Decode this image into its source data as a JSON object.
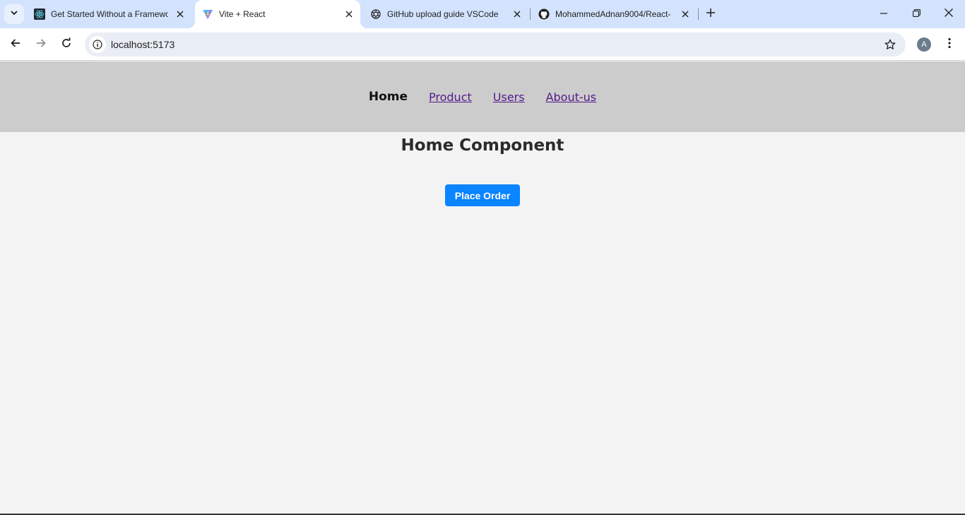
{
  "browser": {
    "tabs": [
      {
        "title": "Get Started Without a Framewo",
        "icon": "react-icon",
        "active": false
      },
      {
        "title": "Vite + React",
        "icon": "vite-icon",
        "active": true
      },
      {
        "title": "GitHub upload guide VSCode",
        "icon": "chatgpt-icon",
        "active": false
      },
      {
        "title": "MohammedAdnan9004/React-",
        "icon": "github-icon",
        "active": false
      }
    ],
    "url": "localhost:5173",
    "profile_initial": "A"
  },
  "nav": {
    "links": [
      {
        "label": "Home",
        "active": true
      },
      {
        "label": "Product",
        "active": false
      },
      {
        "label": "Users",
        "active": false
      },
      {
        "label": "About-us",
        "active": false
      }
    ]
  },
  "main": {
    "title": "Home Component",
    "button_label": "Place Order"
  },
  "colors": {
    "navbar_bg": "#cccccc",
    "page_bg": "#f3f3f3",
    "button_bg": "#0a84ff",
    "link_color": "#551a8b"
  }
}
